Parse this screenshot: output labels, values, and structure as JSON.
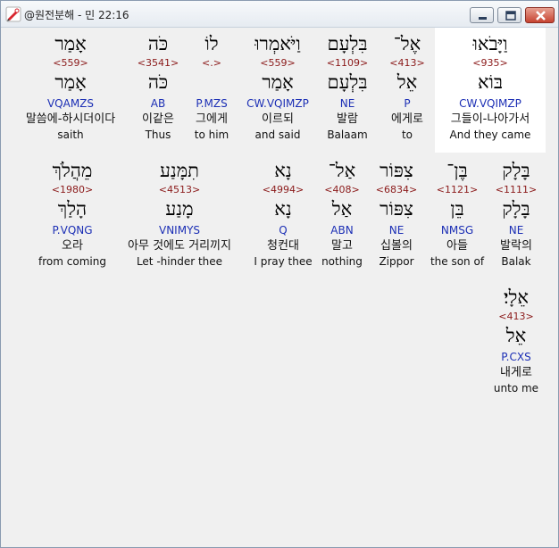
{
  "window": {
    "title": "@원전분해 - 민 22:16"
  },
  "words": [
    {
      "heb": "וַיָּבֹאוּ",
      "strong": "<935>",
      "lemma": "בּוֹא",
      "morph": "CW.VQIMZP",
      "kor": "그들이-나아가서",
      "eng": "And they came"
    },
    {
      "heb": "אֶל־",
      "strong": "<413>",
      "lemma": "אֵל",
      "morph": "P",
      "kor": "에게로",
      "eng": "to"
    },
    {
      "heb": "בִּלְעָם",
      "strong": "<1109>",
      "lemma": "בִּלְעָם",
      "morph": "NE",
      "kor": "발람",
      "eng": "Balaam"
    },
    {
      "heb": "וַיֹּאמְרוּ",
      "strong": "<559>",
      "lemma": "אָמַר",
      "morph": "CW.VQIMZP",
      "kor": "이르되",
      "eng": "and said"
    },
    {
      "heb": "לוֹ",
      "strong": "<.>",
      "lemma": "",
      "morph": "P.MZS",
      "kor": "그에게",
      "eng": "to him"
    },
    {
      "heb": "כֹּה",
      "strong": "<3541>",
      "lemma": "כֹּה",
      "morph": "AB",
      "kor": "이같은",
      "eng": "Thus"
    },
    {
      "heb": "אָמַר",
      "strong": "<559>",
      "lemma": "אָמַר",
      "morph": "VQAMZS",
      "kor": "말씀에-하시더이다",
      "eng": "saith"
    },
    {
      "heb": "בָּלָק",
      "strong": "<1111>",
      "lemma": "בָּלָק",
      "morph": "NE",
      "kor": "발락의",
      "eng": "Balak"
    },
    {
      "heb": "בֶּן־",
      "strong": "<1121>",
      "lemma": "בֵּן",
      "morph": "NMSG",
      "kor": "아들",
      "eng": "the son of"
    },
    {
      "heb": "צִפּוֹר",
      "strong": "<6834>",
      "lemma": "צִפּוֹר",
      "morph": "NE",
      "kor": "십볼의",
      "eng": "Zippor"
    },
    {
      "heb": "אַל־",
      "strong": "<408>",
      "lemma": "אַל",
      "morph": "ABN",
      "kor": "말고",
      "eng": "nothing"
    },
    {
      "heb": "נָא",
      "strong": "<4994>",
      "lemma": "נָא",
      "morph": "Q",
      "kor": "청컨대",
      "eng": "I pray thee"
    },
    {
      "heb": "תִמָּנַע",
      "strong": "<4513>",
      "lemma": "מָנַע",
      "morph": "VNIMYS",
      "kor": "아무 것에도 거리끼지",
      "eng": "Let -hinder thee"
    },
    {
      "heb": "מֵהֲלֹךְ",
      "strong": "<1980>",
      "lemma": "הָלַךְ",
      "morph": "P.VQNG",
      "kor": "오라",
      "eng": "from coming"
    },
    {
      "heb": "אֵלָי׃",
      "strong": "<413>",
      "lemma": "אֵל",
      "morph": "P.CXS",
      "kor": "내게로",
      "eng": "unto me"
    }
  ],
  "colors": {
    "strong": "#8b1a1a",
    "morph": "#1c2fb5",
    "highlight": "#ffffff"
  }
}
